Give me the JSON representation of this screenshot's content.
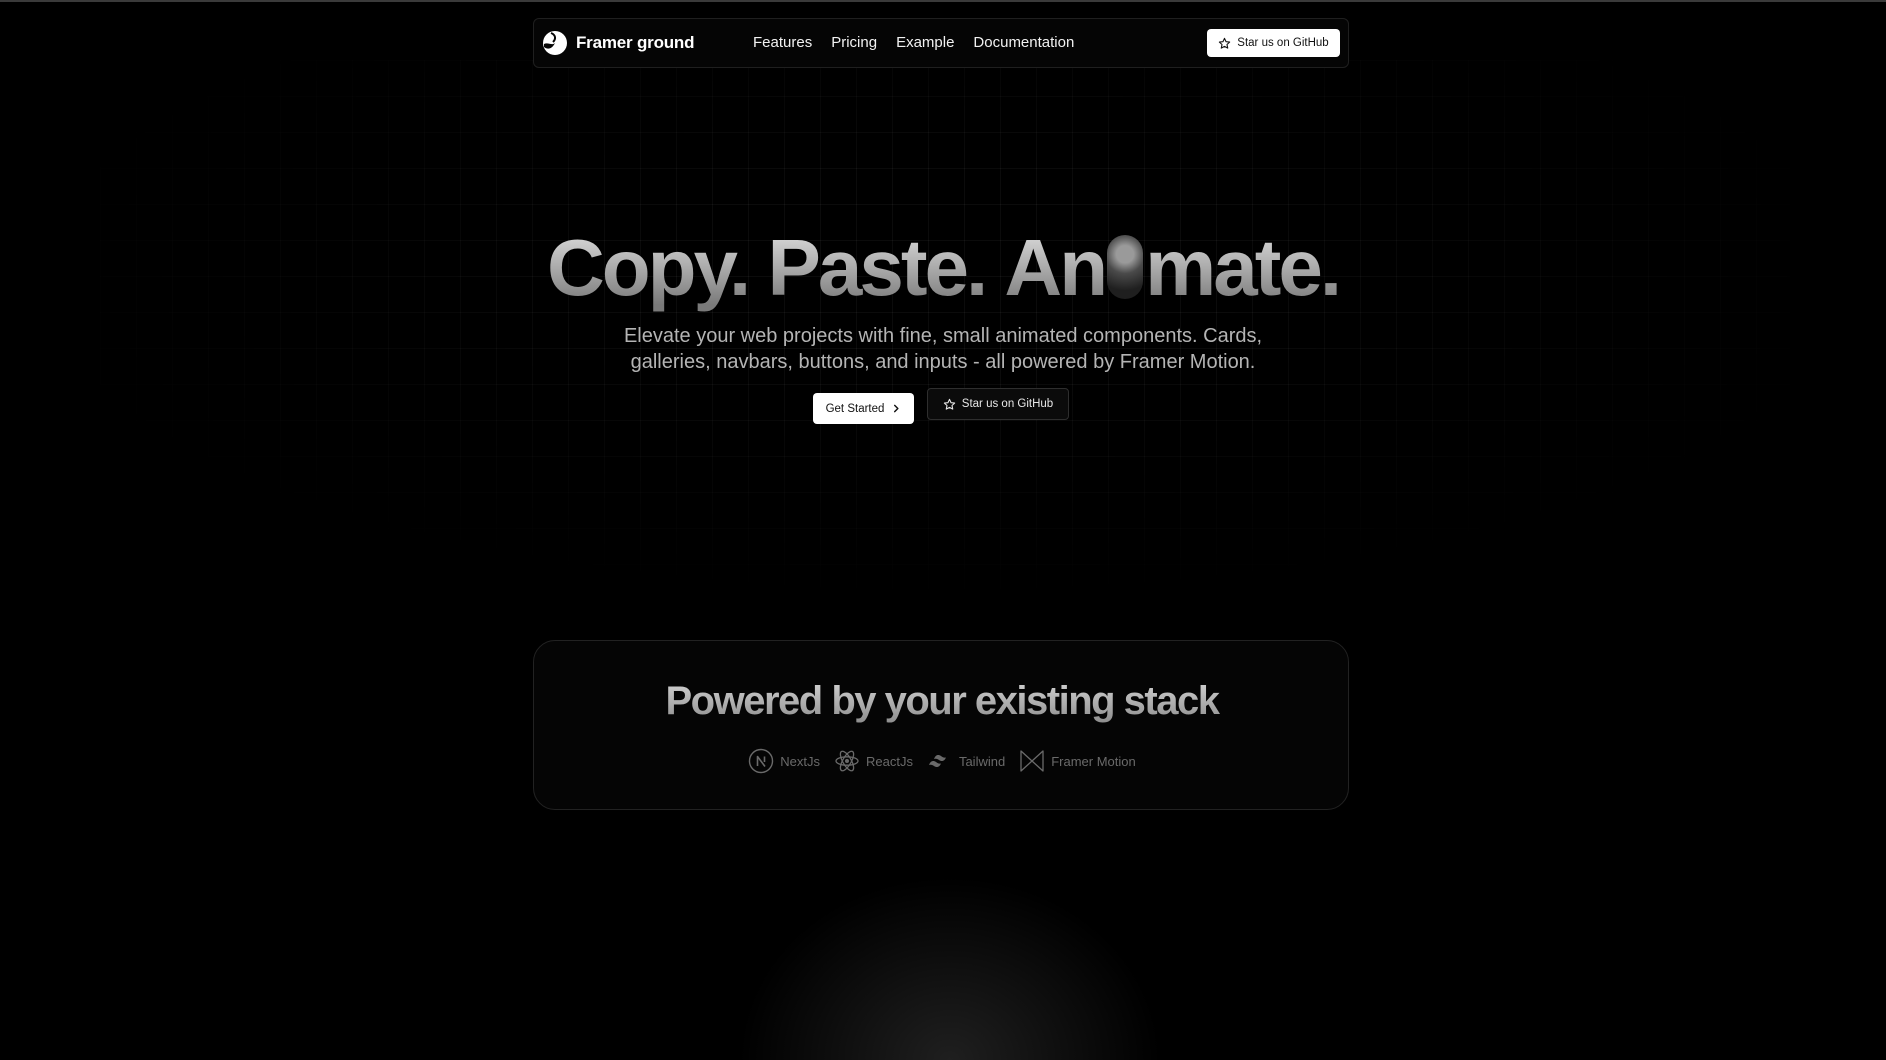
{
  "nav": {
    "brand": "Framer ground",
    "links": [
      "Features",
      "Pricing",
      "Example",
      "Documentation"
    ],
    "star_label": "Star us on GitHub"
  },
  "hero": {
    "title_words": [
      "Copy.",
      "Paste.",
      "An",
      "mate."
    ],
    "subtitle": "Elevate your web projects with fine, small animated components. Cards, galleries, navbars, buttons, and inputs - all powered by Framer Motion.",
    "primary_label": "Get Started",
    "secondary_label": "Star us on GitHub"
  },
  "stack": {
    "title": "Powered by your existing stack",
    "items": [
      {
        "label": "NextJs",
        "icon": "nextjs-icon"
      },
      {
        "label": "ReactJs",
        "icon": "react-icon"
      },
      {
        "label": "Tailwind",
        "icon": "tailwind-icon"
      },
      {
        "label": "Framer Motion",
        "icon": "framer-motion-icon"
      }
    ]
  },
  "colors": {
    "background": "#000000",
    "primary_button": "#ffffff",
    "muted_text": "#6a6a6a"
  }
}
